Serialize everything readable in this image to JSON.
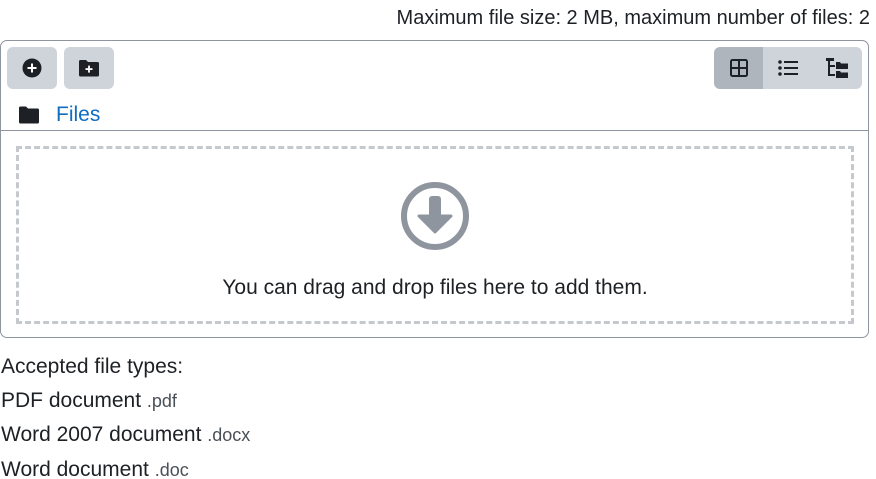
{
  "limits_text": "Maximum file size: 2 MB, maximum number of files: 2",
  "toolbar": {
    "add_icon": "plus-circle-icon",
    "mkdir_icon": "folder-plus-icon",
    "views": [
      {
        "icon": "grid-icon",
        "active": true
      },
      {
        "icon": "list-icon",
        "active": false
      },
      {
        "icon": "tree-icon",
        "active": false
      }
    ]
  },
  "path": {
    "icon": "folder-icon",
    "label": "Files"
  },
  "dropzone": {
    "icon": "download-circle-icon",
    "text": "You can drag and drop files here to add them."
  },
  "accepted": {
    "heading": "Accepted file types:",
    "types": [
      {
        "name": "PDF document",
        "ext": ".pdf"
      },
      {
        "name": "Word 2007 document",
        "ext": ".docx"
      },
      {
        "name": "Word document",
        "ext": ".doc"
      }
    ]
  },
  "colors": {
    "link": "#0f6cbf",
    "button_bg": "#ced4da",
    "button_active_bg": "#aeb5bd",
    "border": "#8f959e",
    "dropzone_border": "#c5c9cd"
  }
}
